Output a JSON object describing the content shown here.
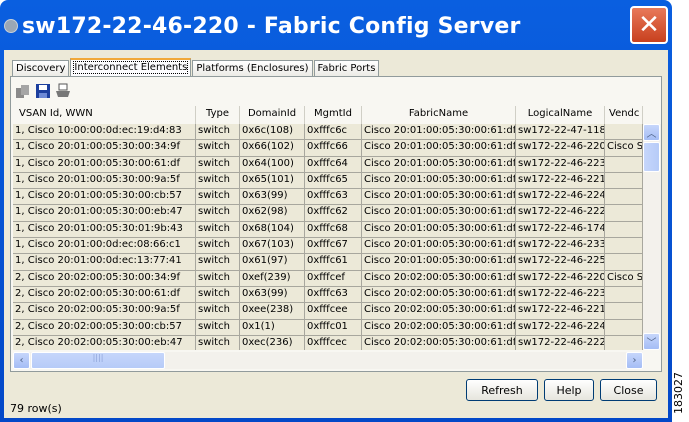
{
  "window": {
    "title": "sw172-22-46-220 - Fabric Config Server",
    "close": "✕"
  },
  "tabs": [
    {
      "label": "Discovery"
    },
    {
      "label": "Interconnect Elements",
      "active": true
    },
    {
      "label": "Platforms (Enclosures)"
    },
    {
      "label": "Fabric Ports"
    }
  ],
  "toolbar": [
    "export-icon",
    "save-icon",
    "print-icon"
  ],
  "table": {
    "columns": [
      "VSAN Id, WWN",
      "Type",
      "DomainId",
      "MgmtId",
      "FabricName",
      "LogicalName",
      "Vendc"
    ],
    "rows": [
      [
        "1, Cisco 10:00:00:0d:ec:19:d4:83",
        "switch",
        "0x6c(108)",
        "0xfffc6c",
        "Cisco 20:01:00:05:30:00:61:df",
        "sw172-22-47-118",
        ""
      ],
      [
        "1, Cisco 20:01:00:05:30:00:34:9f",
        "switch",
        "0x66(102)",
        "0xfffc66",
        "Cisco 20:01:00:05:30:00:61:df",
        "sw172-22-46-220",
        "Cisco S"
      ],
      [
        "1, Cisco 20:01:00:05:30:00:61:df",
        "switch",
        "0x64(100)",
        "0xfffc64",
        "Cisco 20:01:00:05:30:00:61:df",
        "sw172-22-46-223",
        ""
      ],
      [
        "1, Cisco 20:01:00:05:30:00:9a:5f",
        "switch",
        "0x65(101)",
        "0xfffc65",
        "Cisco 20:01:00:05:30:00:61:df",
        "sw172-22-46-221",
        ""
      ],
      [
        "1, Cisco 20:01:00:05:30:00:cb:57",
        "switch",
        "0x63(99)",
        "0xfffc63",
        "Cisco 20:01:00:05:30:00:61:df",
        "sw172-22-46-224",
        ""
      ],
      [
        "1, Cisco 20:01:00:05:30:00:eb:47",
        "switch",
        "0x62(98)",
        "0xfffc62",
        "Cisco 20:01:00:05:30:00:61:df",
        "sw172-22-46-222",
        ""
      ],
      [
        "1, Cisco 20:01:00:05:30:01:9b:43",
        "switch",
        "0x68(104)",
        "0xfffc68",
        "Cisco 20:01:00:05:30:00:61:df",
        "sw172-22-46-174",
        ""
      ],
      [
        "1, Cisco 20:01:00:0d:ec:08:66:c1",
        "switch",
        "0x67(103)",
        "0xfffc67",
        "Cisco 20:01:00:05:30:00:61:df",
        "sw172-22-46-233",
        ""
      ],
      [
        "1, Cisco 20:01:00:0d:ec:13:77:41",
        "switch",
        "0x61(97)",
        "0xfffc61",
        "Cisco 20:01:00:05:30:00:61:df",
        "sw172-22-46-225",
        ""
      ],
      [
        "2, Cisco 20:02:00:05:30:00:34:9f",
        "switch",
        "0xef(239)",
        "0xfffcef",
        "Cisco 20:02:00:05:30:00:61:df",
        "sw172-22-46-220",
        "Cisco S"
      ],
      [
        "2, Cisco 20:02:00:05:30:00:61:df",
        "switch",
        "0x63(99)",
        "0xfffc63",
        "Cisco 20:02:00:05:30:00:61:df",
        "sw172-22-46-223",
        ""
      ],
      [
        "2, Cisco 20:02:00:05:30:00:9a:5f",
        "switch",
        "0xee(238)",
        "0xfffcee",
        "Cisco 20:02:00:05:30:00:61:df",
        "sw172-22-46-221",
        ""
      ],
      [
        "2, Cisco 20:02:00:05:30:00:cb:57",
        "switch",
        "0x1(1)",
        "0xfffc01",
        "Cisco 20:02:00:05:30:00:61:df",
        "sw172-22-46-224",
        ""
      ],
      [
        "2, Cisco 20:02:00:05:30:00:eb:47",
        "switch",
        "0xec(236)",
        "0xfffcec",
        "Cisco 20:02:00:05:30:00:61:df",
        "sw172-22-46-222",
        ""
      ]
    ]
  },
  "buttons": {
    "refresh": "Refresh",
    "help": "Help",
    "close": "Close"
  },
  "status": "79 row(s)",
  "figure_id": "183027",
  "colors": {
    "titlebar": "#0348c8",
    "close": "#d9542e",
    "tab_accent": "#f1a839",
    "panel": "#ece9d8"
  }
}
